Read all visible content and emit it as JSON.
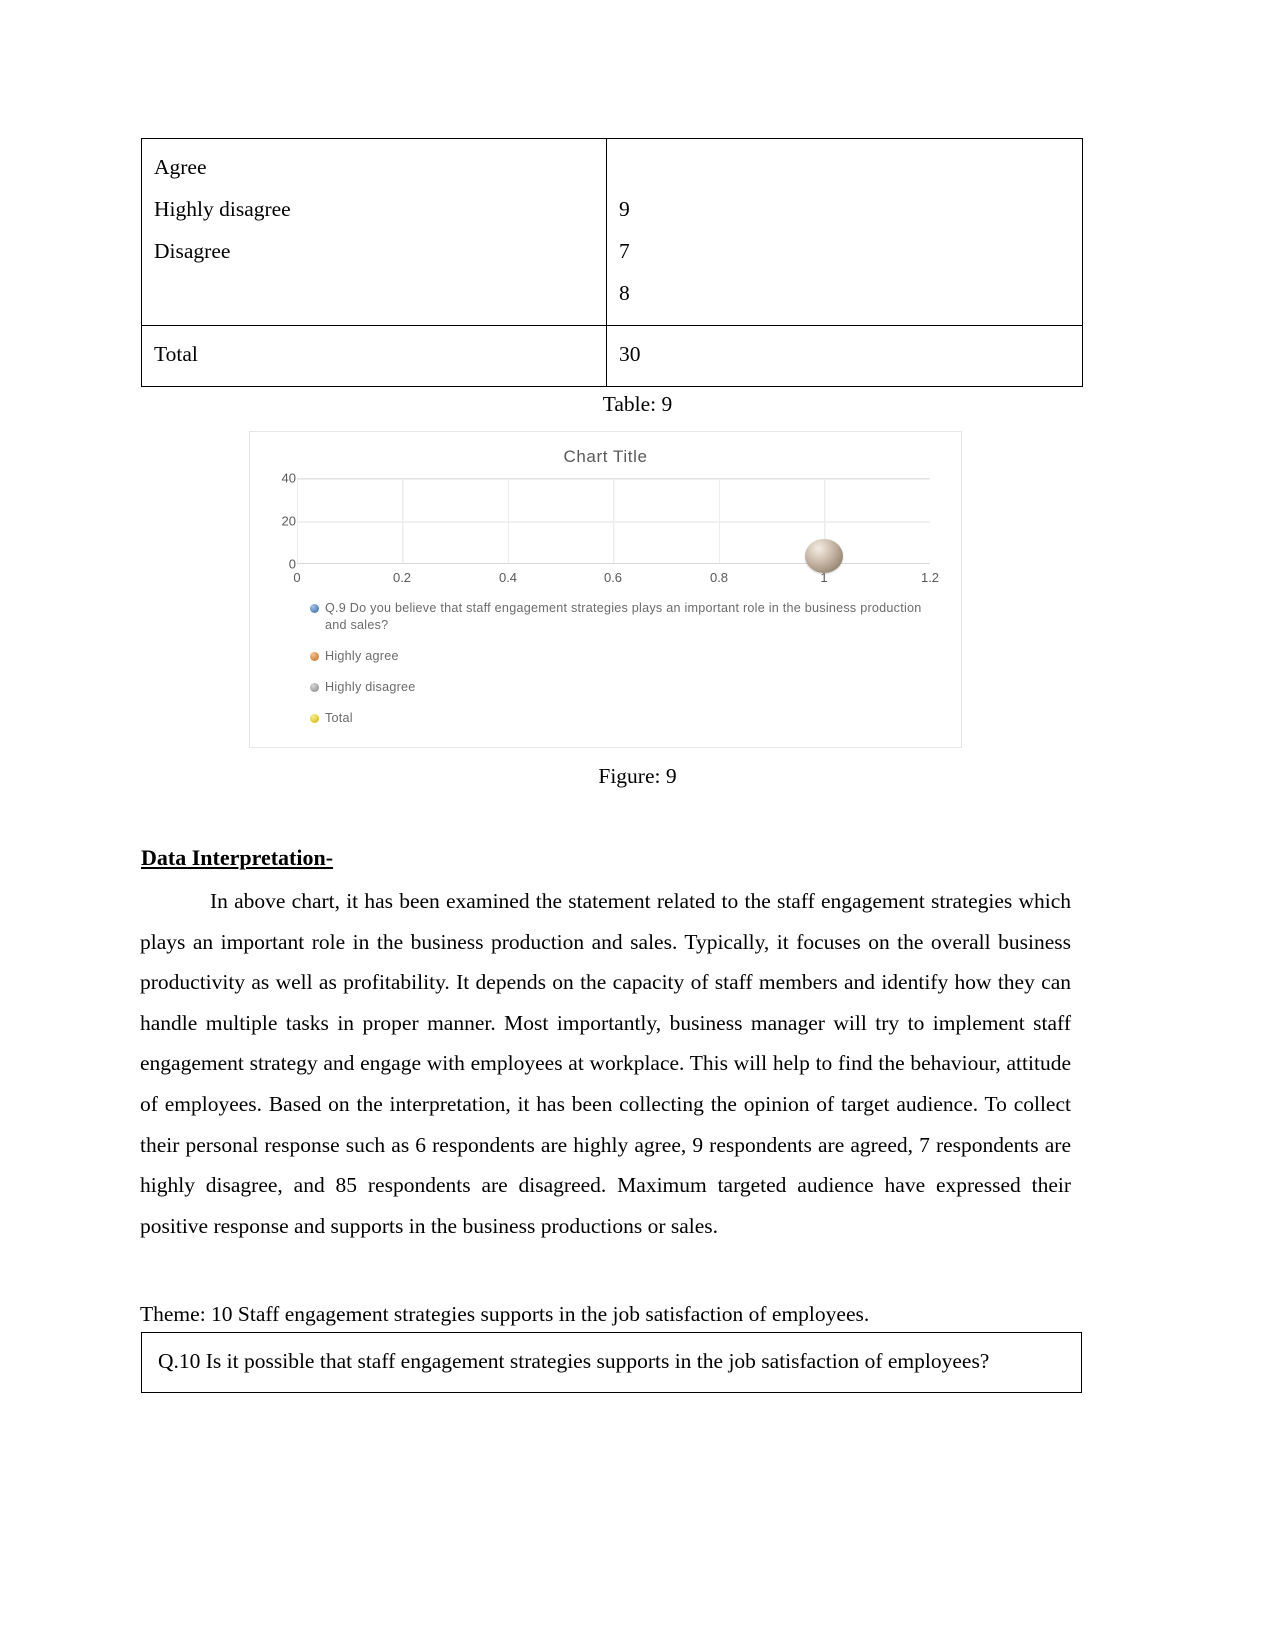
{
  "table": {
    "rows": [
      {
        "label_lines": [
          "Agree",
          "Highly disagree",
          "Disagree",
          ""
        ],
        "value_lines": [
          "",
          "9",
          "7",
          "8"
        ]
      },
      {
        "label_lines": [
          "Total"
        ],
        "value_lines": [
          "30"
        ]
      }
    ]
  },
  "captions": {
    "table": "Table: 9",
    "figure": "Figure: 9"
  },
  "chart_data": {
    "type": "scatter",
    "title": "Chart Title",
    "xlabel": "",
    "ylabel": "",
    "xlim": [
      0,
      1.2
    ],
    "ylim": [
      0,
      40
    ],
    "x_ticks": [
      "0",
      "0.2",
      "0.4",
      "0.6",
      "0.8",
      "1",
      "1.2"
    ],
    "x_tick_values": [
      0,
      0.2,
      0.4,
      0.6,
      0.8,
      1,
      1.2
    ],
    "y_ticks": [
      "40",
      "20",
      "0"
    ],
    "y_tick_values": [
      40,
      20,
      0
    ],
    "grid": true,
    "legend_position": "bottom",
    "series": [
      {
        "name": "Q.9 Do you believe that staff engagement strategies plays an important role in the business production and sales?",
        "color": "#4e81bd",
        "points": []
      },
      {
        "name": "Highly agree",
        "color": "#d98c40",
        "points": []
      },
      {
        "name": "Highly disagree",
        "color": "#9c9c9c",
        "points": []
      },
      {
        "name": "Total",
        "color": "#e8c531",
        "points": []
      }
    ],
    "plotted_points": [
      {
        "x": 1,
        "y": 7,
        "color": "#b3a292"
      }
    ]
  },
  "content": {
    "heading": "Data Interpretation-",
    "paragraph": "In above chart, it has been examined the statement related to the staff engagement strategies which plays an important role in the business production and sales. Typically, it focuses on the overall business productivity as well as profitability. It depends on the capacity of staff members and identify how they can handle multiple tasks in proper manner. Most importantly, business manager will try to implement staff engagement strategy and engage with employees at workplace. This will help to find the behaviour, attitude of employees. Based on the interpretation, it has been collecting the opinion of target audience. To collect their personal response such as 6 respondents are highly agree, 9 respondents are agreed, 7 respondents are highly disagree, and 85 respondents are disagreed. Maximum targeted audience have expressed their positive response and supports in the business productions or sales.",
    "theme_line": "Theme: 10 Staff engagement strategies supports in the job satisfaction of employees.",
    "question_box": "Q.10 Is it possible that staff engagement strategies supports in the job satisfaction of employees?"
  }
}
